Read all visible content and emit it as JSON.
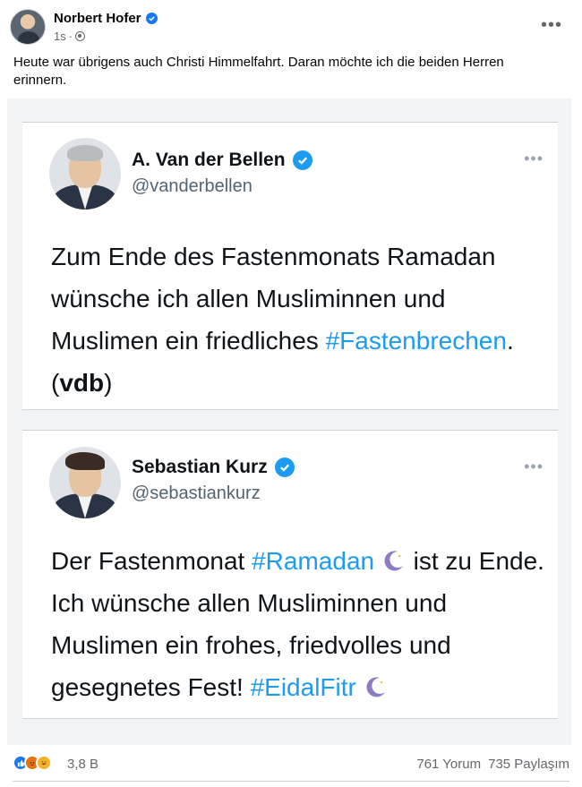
{
  "post": {
    "author": "Norbert Hofer",
    "time": "1s",
    "time_separator": "·",
    "text": "Heute war übrigens auch Christi Himmelfahrt. Daran möchte ich die beiden Herren erinnern.",
    "more_label": "•••"
  },
  "tweets": [
    {
      "name": "A. Van der Bellen",
      "handle": "@vanderbellen",
      "more_label": "•••",
      "text_part1": "Zum Ende des Fastenmonats Ramadan wünsche ich allen Musliminnen und Muslimen ein friedliches ",
      "hashtag1": "#Fastenbrechen",
      "text_part2": ". (",
      "bold_text": "vdb",
      "text_part3": ")"
    },
    {
      "name": "Sebastian Kurz",
      "handle": "@sebastiankurz",
      "more_label": "•••",
      "text_part1": "Der Fastenmonat ",
      "hashtag1": "#Ramadan",
      "text_part2": " ist zu Ende. Ich wünsche allen Musliminnen und Muslimen ein frohes, friedvolles und gesegnetes Fest! ",
      "hashtag2": "#EidalFitr"
    }
  ],
  "footer": {
    "reaction_count": "3,8 B",
    "comments": "761 Yorum",
    "shares": "735 Paylaşım"
  },
  "colors": {
    "facebook_blue": "#1877f2",
    "twitter_blue": "#1d9bf0",
    "secondary_text": "#65676b"
  },
  "icons": [
    "verified-badge-icon",
    "globe-icon",
    "more-options-icon",
    "crescent-moon-icon",
    "like-reaction-icon",
    "angry-reaction-icon",
    "haha-reaction-icon"
  ]
}
